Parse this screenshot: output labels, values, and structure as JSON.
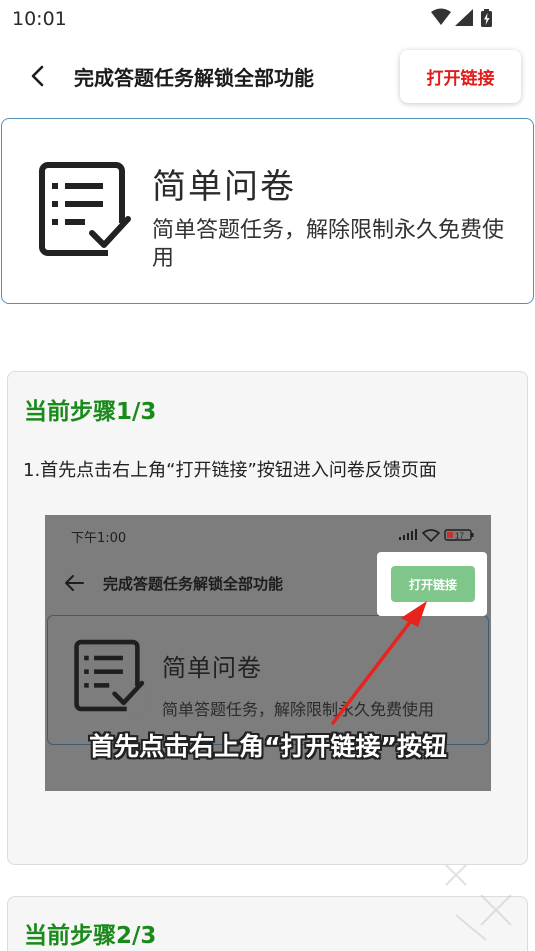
{
  "status_bar": {
    "time": "10:01",
    "icons": [
      "wifi-icon",
      "signal-icon",
      "battery-charging-icon"
    ]
  },
  "app_bar": {
    "title": "完成答题任务解锁全部功能",
    "open_link_label": "打开链接"
  },
  "header_card": {
    "icon": "survey-checklist-icon",
    "title": "简单问卷",
    "description": "简单答题任务，解除限制永久免费使用"
  },
  "steps": [
    {
      "title": "当前步骤1/3",
      "instruction": "1.首先点击右上角“打开链接”按钮进入问卷反馈页面",
      "preview": {
        "time": "下午1:00",
        "battery": "17",
        "title": "完成答题任务解锁全部功能",
        "open_link_label": "打开链接",
        "card_title": "简单问卷",
        "card_description": "简单答题任务，解除限制永久免费使用",
        "caption": "首先点击右上角“打开链接”按钮"
      }
    },
    {
      "title": "当前步骤2/3"
    }
  ],
  "colors": {
    "accent_red": "#e21a1a",
    "step_green": "#1a8a1a",
    "card_border": "#5a8fb5",
    "preview_button_green": "#7fc68a"
  }
}
